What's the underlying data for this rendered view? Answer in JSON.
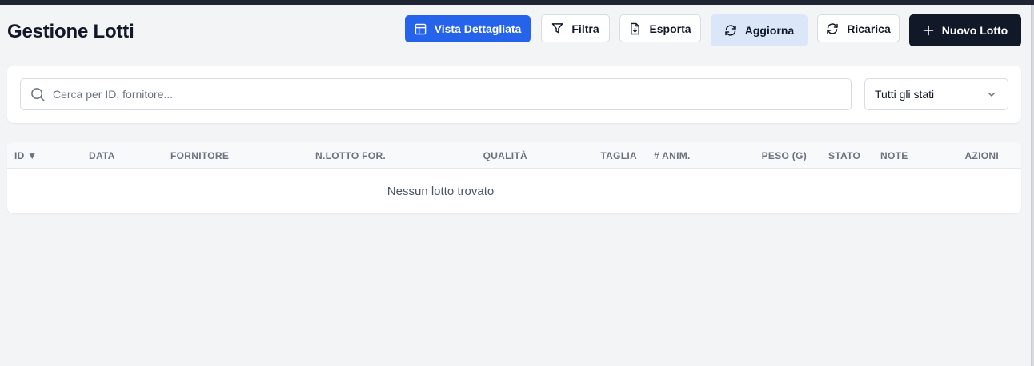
{
  "page": {
    "title": "Gestione Lotti"
  },
  "toolbar": {
    "detailed_view": "Vista Dettagliata",
    "filter": "Filtra",
    "export": "Esporta",
    "update": "Aggiorna",
    "reload": "Ricarica",
    "new_lot": "Nuovo Lotto"
  },
  "filters": {
    "search_placeholder": "Cerca per ID, fornitore...",
    "search_value": "",
    "status_selected": "Tutti gli stati"
  },
  "table": {
    "columns": {
      "id": "ID ▼",
      "date": "DATA",
      "supplier": "FORNITORE",
      "supplier_lot": "N.LOTTO FOR.",
      "quality": "QUALITÀ",
      "size": "TAGLIA",
      "animals": "# ANIM.",
      "weight": "PESO (G)",
      "status": "STATO",
      "notes": "NOTE",
      "actions": "AZIONI"
    },
    "empty_message": "Nessun lotto trovato"
  },
  "icons": {
    "detailed_view": "table-icon",
    "filter": "filter-icon",
    "export": "file-download-icon",
    "update": "refresh-icon",
    "reload": "refresh-icon",
    "new_lot": "plus-icon",
    "search": "search-icon",
    "status_select": "chevron-down-icon"
  },
  "colors": {
    "primary": "#2563eb",
    "dark": "#111827",
    "soft_blue": "#dbe7f8",
    "background": "#f3f4f6"
  }
}
